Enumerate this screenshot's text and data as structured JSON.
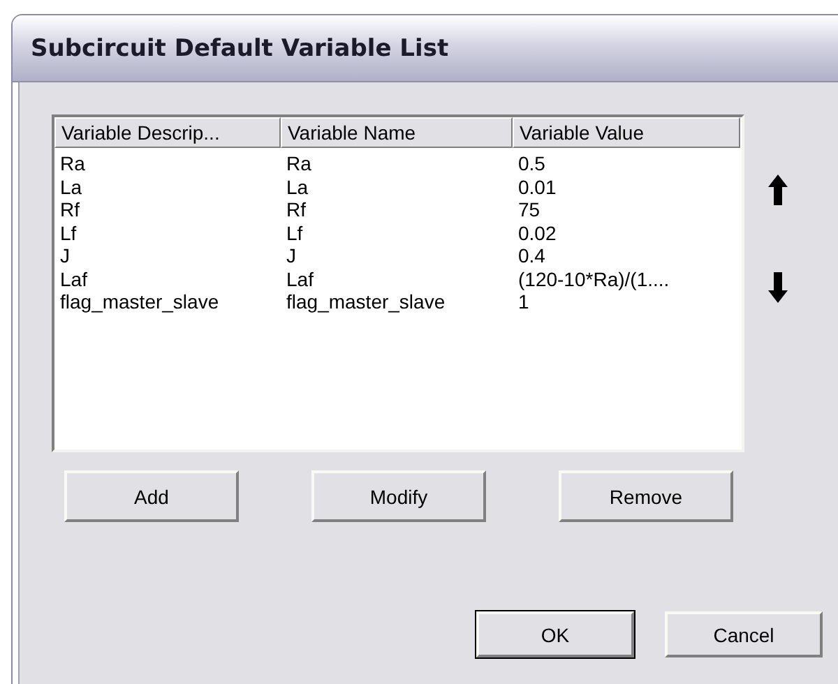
{
  "window": {
    "title": "Subcircuit Default Variable List"
  },
  "table": {
    "columns": [
      "Variable Descrip...",
      "Variable Name",
      "Variable Value"
    ],
    "rows": [
      [
        "Ra",
        "Ra",
        "0.5"
      ],
      [
        "La",
        "La",
        "0.01"
      ],
      [
        "Rf",
        "Rf",
        "75"
      ],
      [
        "Lf",
        "Lf",
        "0.02"
      ],
      [
        "J",
        "J",
        "0.4"
      ],
      [
        "Laf",
        "Laf",
        "(120-10*Ra)/(1...."
      ],
      [
        "flag_master_slave",
        "flag_master_slave",
        "1"
      ]
    ]
  },
  "list_buttons": [
    "Add",
    "Modify",
    "Remove"
  ],
  "dialog_buttons": [
    {
      "label": "OK",
      "default": true
    },
    {
      "label": "Cancel",
      "default": false
    }
  ]
}
